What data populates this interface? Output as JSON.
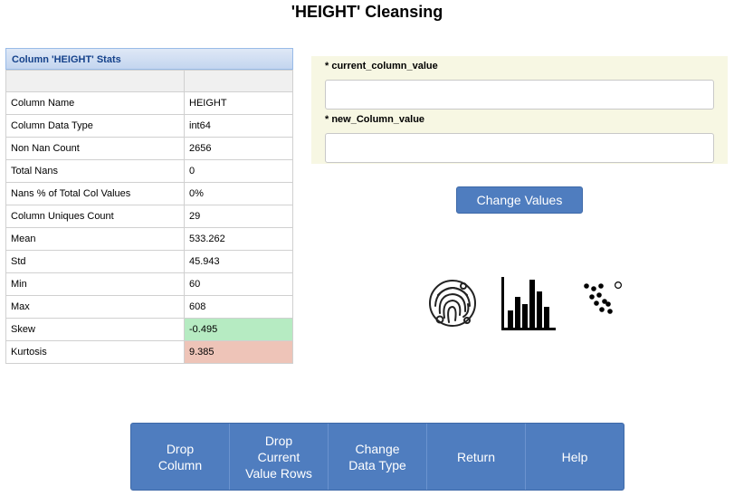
{
  "page": {
    "title": "'HEIGHT' Cleansing"
  },
  "stats": {
    "header": "Column 'HEIGHT' Stats",
    "rows": [
      {
        "label": "Column Name",
        "value": "HEIGHT"
      },
      {
        "label": "Column Data Type",
        "value": "int64"
      },
      {
        "label": "Non Nan Count",
        "value": "2656"
      },
      {
        "label": "Total Nans",
        "value": "0"
      },
      {
        "label": "Nans % of Total Col Values",
        "value": "0%"
      },
      {
        "label": "Column Uniques Count",
        "value": "29"
      },
      {
        "label": "Mean",
        "value": "533.262"
      },
      {
        "label": "Std",
        "value": "45.943"
      },
      {
        "label": "Min",
        "value": "60"
      },
      {
        "label": "Max",
        "value": "608"
      },
      {
        "label": "Skew",
        "value": "-0.495",
        "highlight": "#b6ebc2"
      },
      {
        "label": "Kurtosis",
        "value": "9.385",
        "highlight": "#eec4b8"
      }
    ]
  },
  "form": {
    "current_label": "* current_column_value",
    "current_value": "",
    "new_label": "* new_Column_value",
    "new_value": "",
    "submit_label": "Change Values"
  },
  "icons": [
    "fingerprint-icon",
    "bar-chart-icon",
    "scatter-plot-icon"
  ],
  "buttons": {
    "drop_column": "Drop\nColumn",
    "drop_rows": "Drop\nCurrent\nValue Rows",
    "change_type": "Change\nData Type",
    "return": "Return",
    "help": "Help"
  },
  "colors": {
    "accent": "#4f7dbf",
    "form_bg": "#f7f7e3"
  }
}
